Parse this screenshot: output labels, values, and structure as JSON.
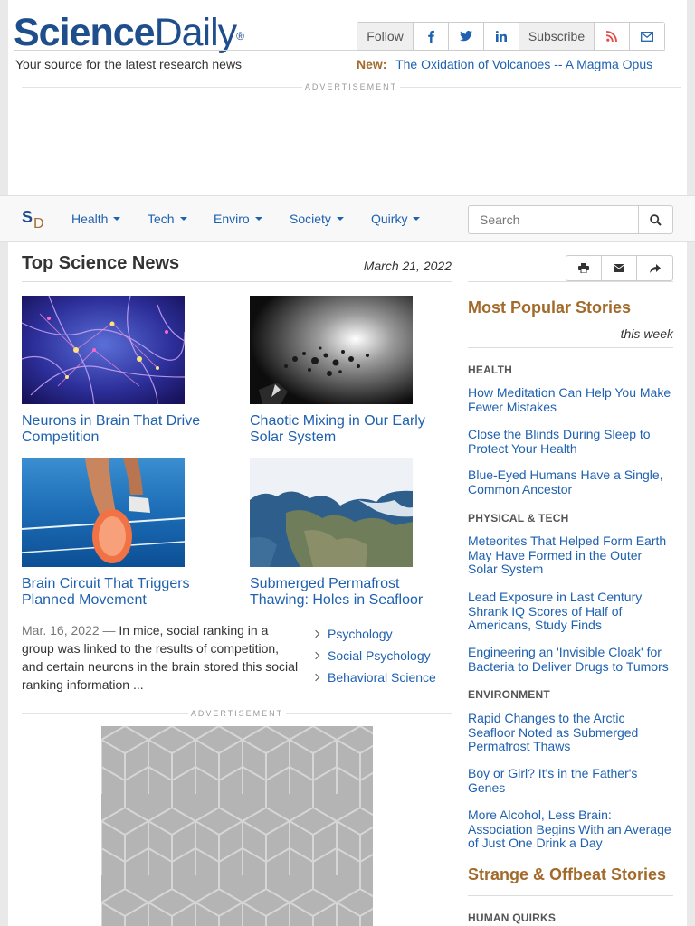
{
  "header": {
    "logo_science": "Science",
    "logo_daily": "Daily",
    "logo_reg": "®",
    "tagline": "Your source for the latest research news",
    "follow_label": "Follow",
    "subscribe_label": "Subscribe",
    "new_label": "New:",
    "new_headline": "The Oxidation of Volcanoes -- A Magma Opus"
  },
  "ads": {
    "label": "ADVERTISEMENT"
  },
  "navbar": {
    "logo_s": "S",
    "logo_d": "D",
    "items": [
      {
        "label": "Health"
      },
      {
        "label": "Tech"
      },
      {
        "label": "Enviro"
      },
      {
        "label": "Society"
      },
      {
        "label": "Quirky"
      }
    ],
    "search_placeholder": "Search"
  },
  "main": {
    "title": "Top Science News",
    "date": "March 21, 2022",
    "stories": [
      {
        "title": "Neurons in Brain That Drive Competition"
      },
      {
        "title": "Chaotic Mixing in Our Early Solar System"
      },
      {
        "title": "Brain Circuit That Triggers Planned Movement"
      },
      {
        "title": "Submerged Permafrost Thawing: Holes in Seafloor"
      }
    ],
    "summary_date": "Mar. 16, 2022",
    "summary_dash": " — ",
    "summary_text": "In mice, social ranking in a group was linked to the results of competition, and certain neurons in the brain stored this social ranking information ...",
    "topics": [
      "Psychology",
      "Social Psychology",
      "Behavioral Science"
    ]
  },
  "sidebar": {
    "popular_title": "Most Popular Stories",
    "popular_sub": "this week",
    "categories": [
      {
        "heading": "HEALTH",
        "links": [
          "How Meditation Can Help You Make Fewer Mistakes",
          "Close the Blinds During Sleep to Protect Your Health",
          "Blue-Eyed Humans Have a Single, Common Ancestor"
        ]
      },
      {
        "heading": "PHYSICAL & TECH",
        "links": [
          "Meteorites That Helped Form Earth May Have Formed in the Outer Solar System",
          "Lead Exposure in Last Century Shrank IQ Scores of Half of Americans, Study Finds",
          "Engineering an 'Invisible Cloak' for Bacteria to Deliver Drugs to Tumors"
        ]
      },
      {
        "heading": "ENVIRONMENT",
        "links": [
          "Rapid Changes to the Arctic Seafloor Noted as Submerged Permafrost Thaws",
          "Boy or Girl? It's in the Father's Genes",
          "More Alcohol, Less Brain: Association Begins With an Average of Just One Drink a Day"
        ]
      }
    ],
    "strange_title": "Strange & Offbeat Stories",
    "strange_heading": "HUMAN QUIRKS"
  },
  "colors": {
    "brand_blue": "#1f4e8c",
    "link_blue": "#1e61b0",
    "accent_brown": "#a26b2c",
    "rss_orange": "#e2504d"
  },
  "icons": {
    "facebook": "facebook-icon",
    "twitter": "twitter-icon",
    "linkedin": "linkedin-icon",
    "rss": "rss-icon",
    "email": "envelope-icon",
    "search": "search-icon",
    "print": "print-icon",
    "share": "share-icon"
  }
}
